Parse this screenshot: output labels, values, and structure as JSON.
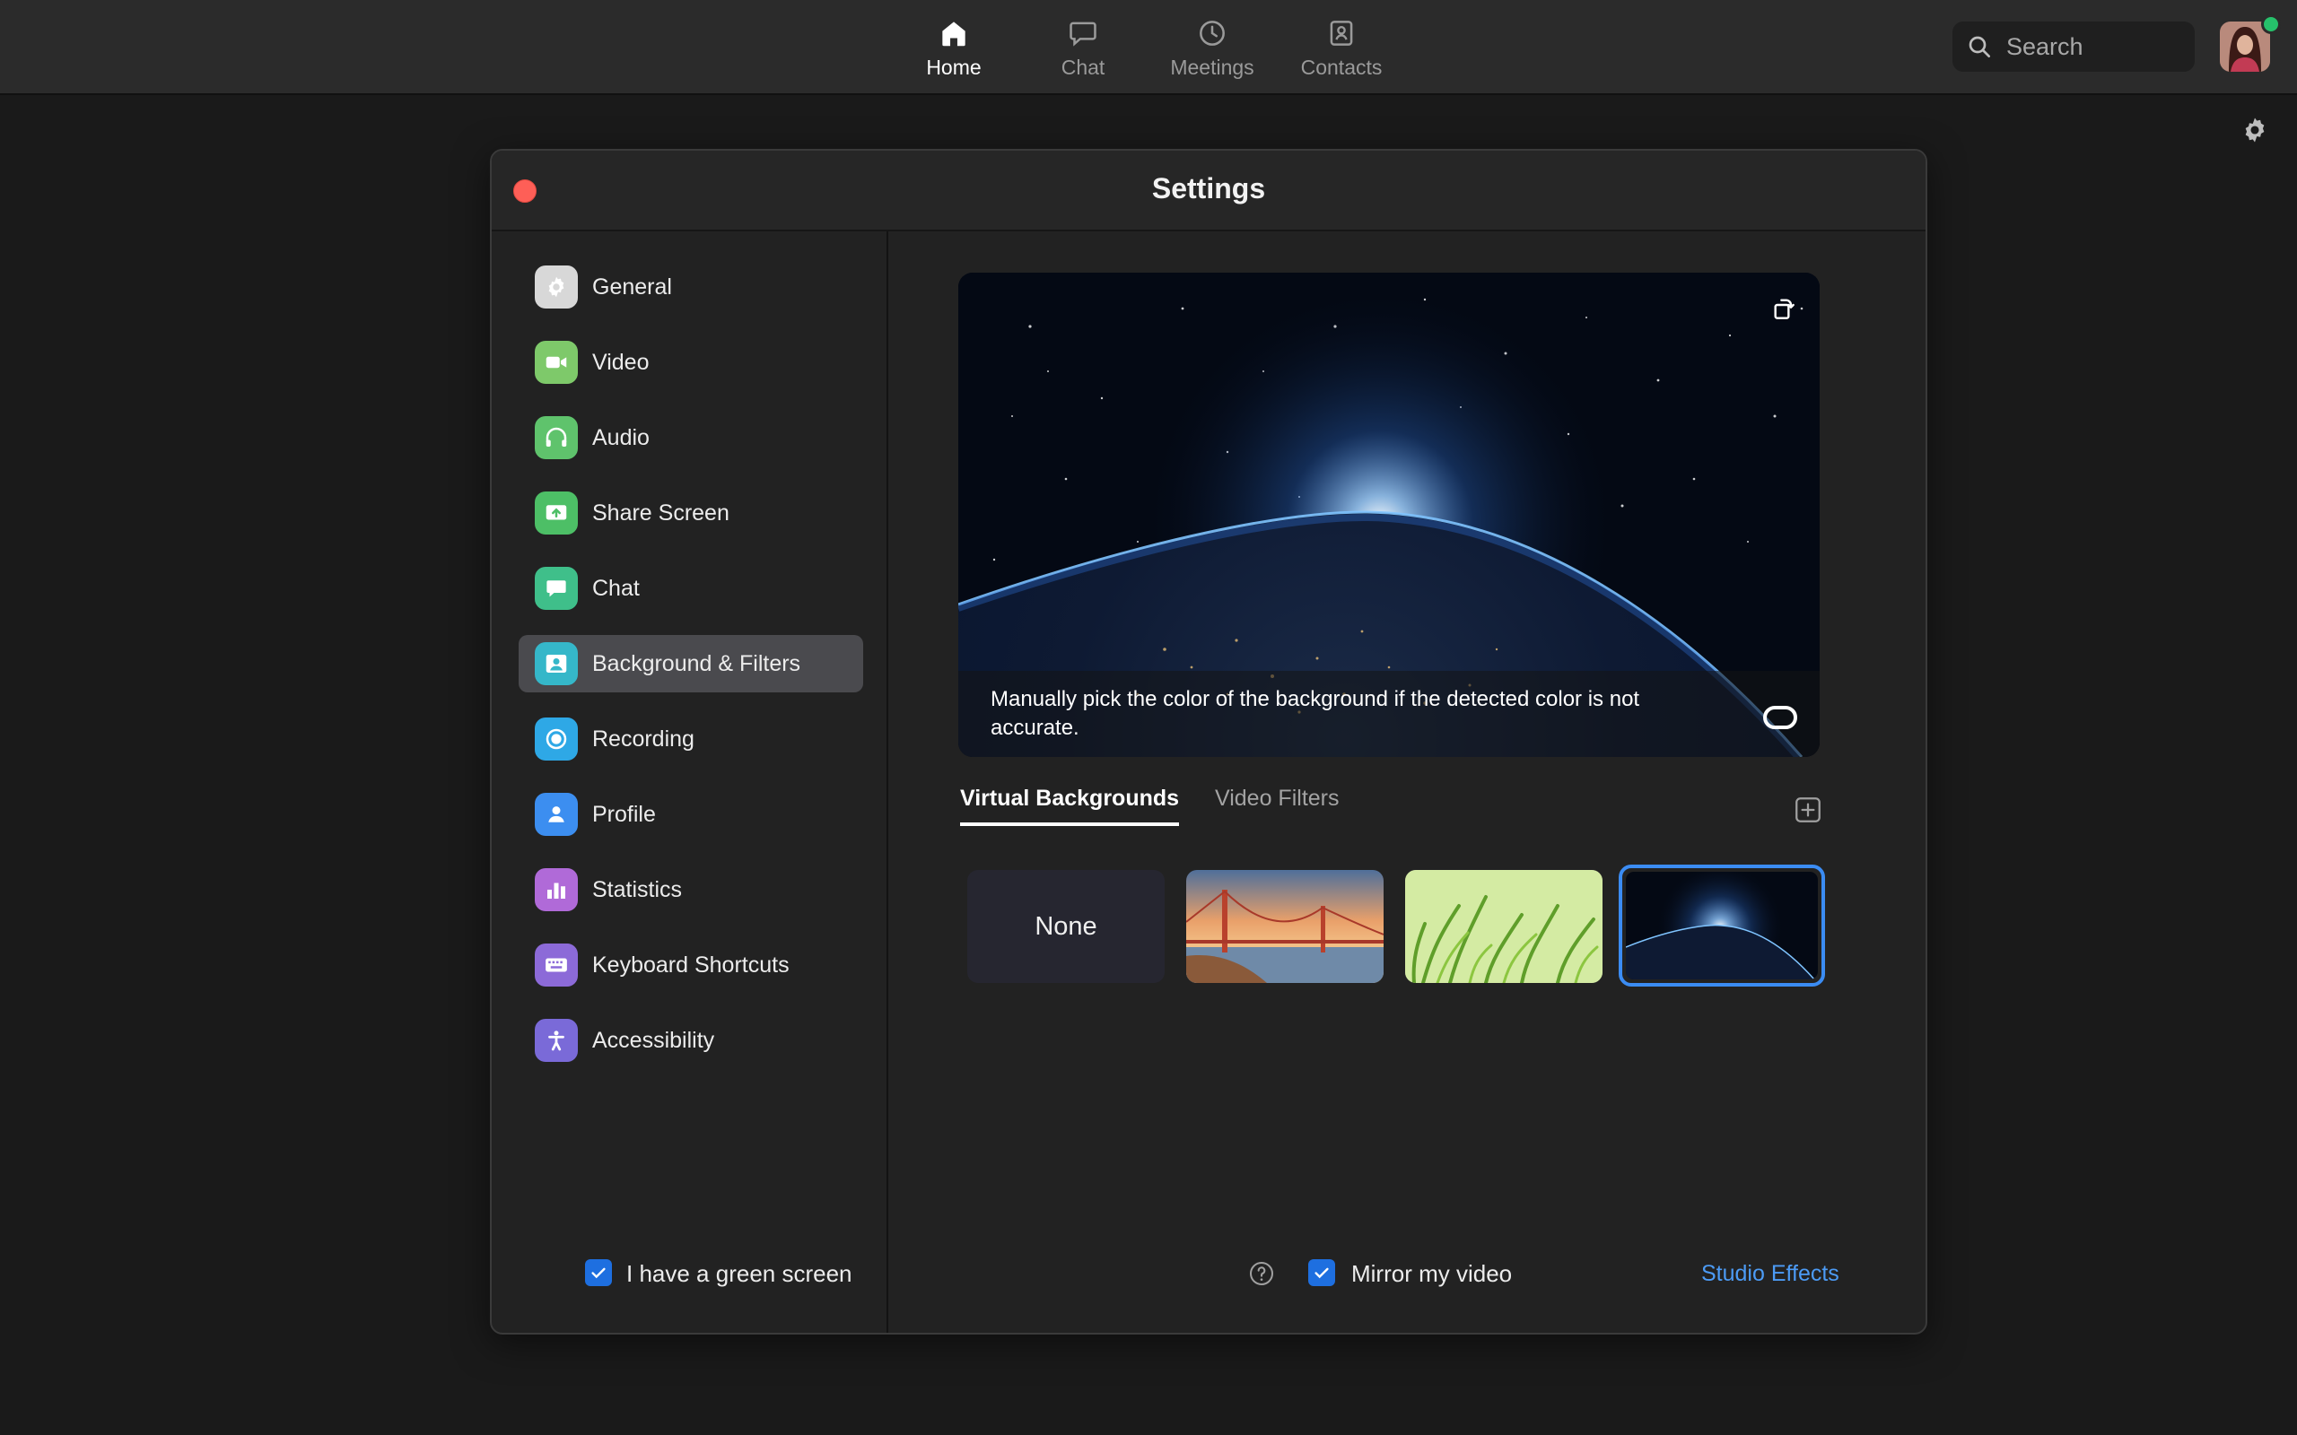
{
  "topbar": {
    "nav": [
      {
        "label": "Home",
        "icon": "home-icon",
        "active": true
      },
      {
        "label": "Chat",
        "icon": "chat-bubble-icon"
      },
      {
        "label": "Meetings",
        "icon": "clock-icon"
      },
      {
        "label": "Contacts",
        "icon": "contact-card-icon"
      }
    ],
    "search_placeholder": "Search",
    "presence_color": "#26c16b"
  },
  "settings": {
    "title": "Settings",
    "sidebar": [
      {
        "label": "General",
        "icon": "gear-icon",
        "color": "#d8d8d8"
      },
      {
        "label": "Video",
        "icon": "video-camera-icon",
        "color": "#7ec96a"
      },
      {
        "label": "Audio",
        "icon": "headphones-icon",
        "color": "#5fc36c"
      },
      {
        "label": "Share Screen",
        "icon": "share-screen-icon",
        "color": "#4dbf66"
      },
      {
        "label": "Chat",
        "icon": "chat-bubble-icon",
        "color": "#3fbf8a"
      },
      {
        "label": "Background & Filters",
        "icon": "person-frame-icon",
        "color": "#35b7c9",
        "active": true
      },
      {
        "label": "Recording",
        "icon": "record-icon",
        "color": "#2ea8e6"
      },
      {
        "label": "Profile",
        "icon": "person-icon",
        "color": "#3c8ef0"
      },
      {
        "label": "Statistics",
        "icon": "bar-chart-icon",
        "color": "#b06ad8"
      },
      {
        "label": "Keyboard Shortcuts",
        "icon": "keyboard-icon",
        "color": "#8c6ad8"
      },
      {
        "label": "Accessibility",
        "icon": "accessibility-icon",
        "color": "#7a6ad8"
      }
    ],
    "preview": {
      "message": "Manually pick the color of the background if the detected color is not accurate."
    },
    "tabs": [
      {
        "label": "Virtual Backgrounds",
        "active": true
      },
      {
        "label": "Video Filters"
      }
    ],
    "backgrounds": [
      {
        "label": "None"
      },
      {
        "name": "golden-gate-bridge"
      },
      {
        "name": "grass"
      },
      {
        "name": "earth-from-space",
        "selected": true
      }
    ],
    "options": {
      "green_screen_label": "I have a green screen",
      "green_screen_checked": true,
      "mirror_label": "Mirror my video",
      "mirror_checked": true,
      "studio_effects_label": "Studio Effects"
    },
    "accent_color": "#3b8cf3",
    "close_color": "#fe5f57"
  }
}
